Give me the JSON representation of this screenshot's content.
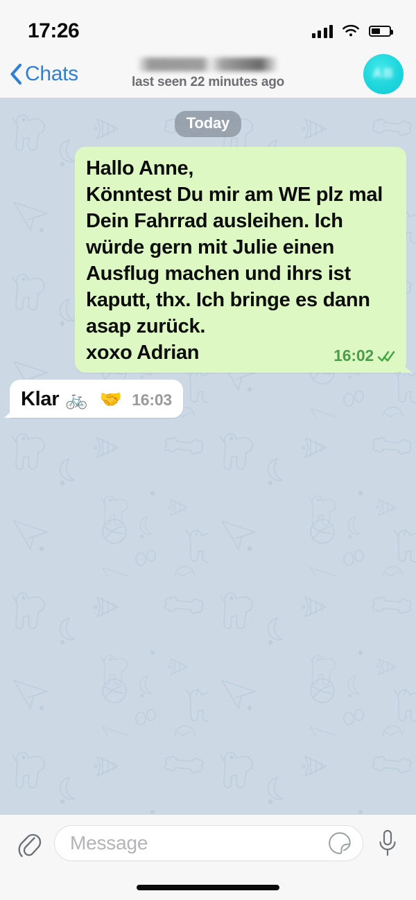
{
  "status_bar": {
    "time": "17:26",
    "signal_icon": "signal-bars-icon",
    "wifi_icon": "wifi-icon",
    "battery_icon": "battery-icon",
    "battery_level_percent": 50
  },
  "navbar": {
    "back_label": "Chats",
    "back_icon": "chevron-left-icon",
    "contact_name": "",
    "contact_name_redacted": true,
    "contact_status": "last seen 22 minutes ago",
    "avatar_initials": "",
    "avatar_color": "#1ed6dd",
    "accent_color": "#2f7fd4"
  },
  "chat": {
    "background_color": "#ccd9e5",
    "date_divider": "Today",
    "messages": [
      {
        "direction": "outgoing",
        "text": "Hallo Anne,\nKönntest Du mir am WE plz mal Dein Fahrrad ausleihen. Ich würde gern mit Julie einen Ausflug machen und ihrs ist kaputt, thx. Ich bringe es dann asap zurück.\nxoxo Adrian",
        "time": "16:02",
        "status_icon": "double-check-icon",
        "read": true,
        "bubble_color": "#ddf8c2",
        "time_color": "#4f9b4f"
      },
      {
        "direction": "incoming",
        "text": "Klar",
        "emojis": "🚲 🤝",
        "time": "16:03",
        "bubble_color": "#ffffff",
        "time_color": "#9a9a9e"
      }
    ]
  },
  "input_bar": {
    "attach_icon": "paperclip-icon",
    "placeholder": "Message",
    "value": "",
    "sticker_icon": "sticker-icon",
    "mic_icon": "microphone-icon"
  },
  "home_indicator": "home-indicator"
}
